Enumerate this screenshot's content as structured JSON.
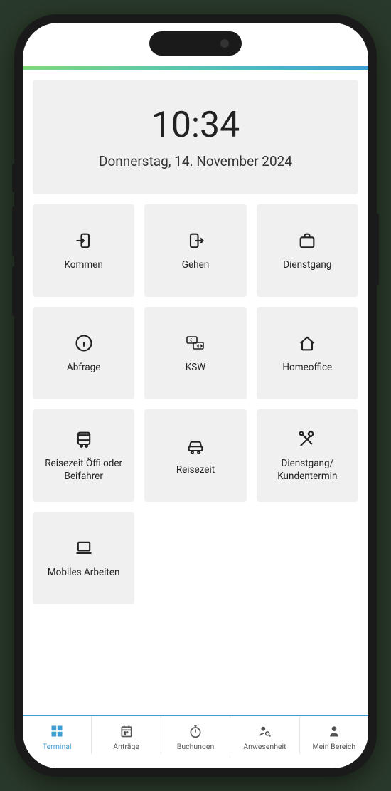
{
  "clock": {
    "time": "10:34",
    "date": "Donnerstag, 14. November 2024"
  },
  "tiles": [
    {
      "id": "kommen",
      "label": "Kommen",
      "icon": "login"
    },
    {
      "id": "gehen",
      "label": "Gehen",
      "icon": "logout"
    },
    {
      "id": "dienstgang",
      "label": "Dienstgang",
      "icon": "briefcase"
    },
    {
      "id": "abfrage",
      "label": "Abfrage",
      "icon": "info"
    },
    {
      "id": "ksw",
      "label": "KSW",
      "icon": "money-sync"
    },
    {
      "id": "homeoffice",
      "label": "Homeoffice",
      "icon": "home"
    },
    {
      "id": "reise-oeffi",
      "label": "Reisezeit Öffi oder Beifahrer",
      "icon": "bus"
    },
    {
      "id": "reisezeit",
      "label": "Reisezeit",
      "icon": "car"
    },
    {
      "id": "dienstgang-kunde",
      "label": "Dienstgang/ Kundentermin",
      "icon": "tools"
    },
    {
      "id": "mobiles-arbeiten",
      "label": "Mobiles Arbeiten",
      "icon": "laptop"
    }
  ],
  "nav": [
    {
      "id": "terminal",
      "label": "Terminal",
      "icon": "grid",
      "active": true
    },
    {
      "id": "antraege",
      "label": "Anträge",
      "icon": "calendar",
      "active": false
    },
    {
      "id": "buchungen",
      "label": "Buchungen",
      "icon": "stopwatch",
      "active": false
    },
    {
      "id": "anwesenheit",
      "label": "Anwesenheit",
      "icon": "person-search",
      "active": false
    },
    {
      "id": "mein-bereich",
      "label": "Mein Bereich",
      "icon": "person",
      "active": false
    }
  ]
}
